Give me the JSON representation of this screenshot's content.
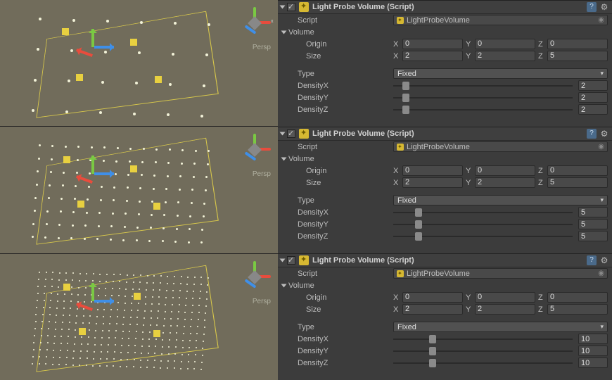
{
  "persp_label": "Persp",
  "panels": [
    {
      "title": "Light Probe Volume (Script)",
      "script_label": "Script",
      "script_value": "LightProbeVolume",
      "volume_label": "Volume",
      "origin_label": "Origin",
      "origin": {
        "x": "0",
        "y": "0",
        "z": "0"
      },
      "size_label": "Size",
      "size": {
        "x": "2",
        "y": "2",
        "z": "5"
      },
      "type_label": "Type",
      "type_value": "Fixed",
      "densityX_label": "DensityX",
      "densityX_value": "2",
      "densityY_label": "DensityY",
      "densityY_value": "2",
      "densityZ_label": "DensityZ",
      "densityZ_value": "2",
      "thumb_pct": "5%"
    },
    {
      "title": "Light Probe Volume (Script)",
      "script_label": "Script",
      "script_value": "LightProbeVolume",
      "volume_label": "Volume",
      "origin_label": "Origin",
      "origin": {
        "x": "0",
        "y": "0",
        "z": "0"
      },
      "size_label": "Size",
      "size": {
        "x": "2",
        "y": "2",
        "z": "5"
      },
      "type_label": "Type",
      "type_value": "Fixed",
      "densityX_label": "DensityX",
      "densityX_value": "5",
      "densityY_label": "DensityY",
      "densityY_value": "5",
      "densityZ_label": "DensityZ",
      "densityZ_value": "5",
      "thumb_pct": "12%"
    },
    {
      "title": "Light Probe Volume (Script)",
      "script_label": "Script",
      "script_value": "LightProbeVolume",
      "volume_label": "Volume",
      "origin_label": "Origin",
      "origin": {
        "x": "0",
        "y": "0",
        "z": "0"
      },
      "size_label": "Size",
      "size": {
        "x": "2",
        "y": "2",
        "z": "5"
      },
      "type_label": "Type",
      "type_value": "Fixed",
      "densityX_label": "DensityX",
      "densityX_value": "10",
      "densityY_label": "DensityY",
      "densityY_value": "10",
      "densityZ_label": "DensityZ",
      "densityZ_value": "10",
      "thumb_pct": "20%"
    }
  ]
}
